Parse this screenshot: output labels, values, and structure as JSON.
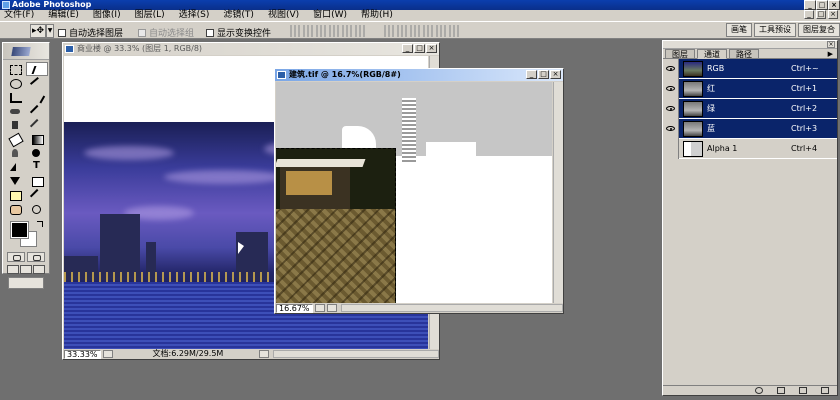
{
  "app": {
    "title": "Adobe Photoshop"
  },
  "menu": {
    "items": [
      "文件(F)",
      "编辑(E)",
      "图像(I)",
      "图层(L)",
      "选择(S)",
      "滤镜(T)",
      "视图(V)",
      "窗口(W)",
      "帮助(H)"
    ]
  },
  "options_bar": {
    "auto_select_layer": "自动选择图层",
    "auto_select_group": "自动选择组",
    "show_transform": "显示变换控件",
    "palette_well": [
      "画笔",
      "工具预设",
      "图层复合"
    ]
  },
  "doc1": {
    "title": "商业楼 @ 33.3% (图层 1, RGB/8)",
    "zoom": "33.33%",
    "doc_size": "文档:6.29M/29.5M"
  },
  "doc2": {
    "title": "建筑.tif @ 16.7%(RGB/8#)",
    "zoom": "16.67%"
  },
  "panel": {
    "tabs": [
      "图层",
      "通道",
      "路径"
    ],
    "channels": [
      {
        "name": "RGB",
        "shortcut": "Ctrl+~",
        "selected": true,
        "visible": true
      },
      {
        "name": "红",
        "shortcut": "Ctrl+1",
        "selected": true,
        "visible": true
      },
      {
        "name": "绿",
        "shortcut": "Ctrl+2",
        "selected": true,
        "visible": true
      },
      {
        "name": "蓝",
        "shortcut": "Ctrl+3",
        "selected": true,
        "visible": true
      },
      {
        "name": "Alpha 1",
        "shortcut": "Ctrl+4",
        "selected": false,
        "visible": false
      }
    ]
  },
  "colors": {
    "foreground": "#000000",
    "background": "#ffffff",
    "selection": "#0a246a"
  }
}
